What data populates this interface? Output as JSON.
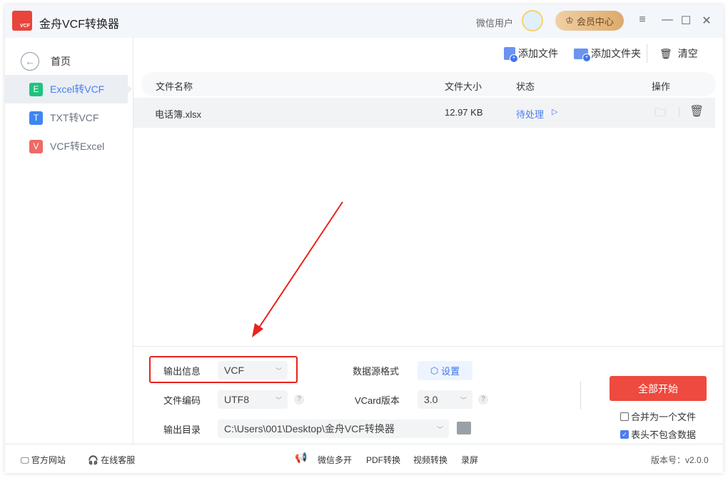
{
  "app": {
    "title": "金舟VCF转换器",
    "logo_text": "VCF",
    "user": "微信用户",
    "vip": "会员中心"
  },
  "sidebar": {
    "home": "首页",
    "items": [
      {
        "label": "Excel转VCF",
        "icon": "E",
        "color": "#1ec47e"
      },
      {
        "label": "TXT转VCF",
        "icon": "T",
        "color": "#3f85f0"
      },
      {
        "label": "VCF转Excel",
        "icon": "V",
        "color": "#ee6a65"
      }
    ]
  },
  "toolbar": {
    "add_file": "添加文件",
    "add_folder": "添加文件夹",
    "clear": "清空"
  },
  "table": {
    "headers": [
      "文件名称",
      "文件大小",
      "状态",
      "操作"
    ],
    "rows": [
      {
        "name": "电话簿.xlsx",
        "size": "12.97 KB",
        "status": "待处理"
      }
    ]
  },
  "settings": {
    "output_info_label": "输出信息",
    "output_info": "VCF",
    "encoding_label": "文件编码",
    "encoding": "UTF8",
    "source_format_label": "数据源格式",
    "set_button": "设置",
    "vcard_label": "VCard版本",
    "vcard": "3.0",
    "dir_label": "输出目录",
    "dir": "C:\\Users\\001\\Desktop\\金舟VCF转换器",
    "help": "?"
  },
  "actions": {
    "start": "全部开始",
    "merge": "合并为一个文件",
    "merge_checked": false,
    "no_header": "表头不包含数据",
    "no_header_checked": true
  },
  "footer": {
    "website": "官方网站",
    "service": "在线客服",
    "links": [
      "微信多开",
      "PDF转换",
      "视频转换",
      "录屏"
    ],
    "version": "版本号：v2.0.0"
  },
  "colors": {
    "accent": "#4a7ef3",
    "start": "#ee4a3f",
    "highlight": "#e8231c"
  }
}
